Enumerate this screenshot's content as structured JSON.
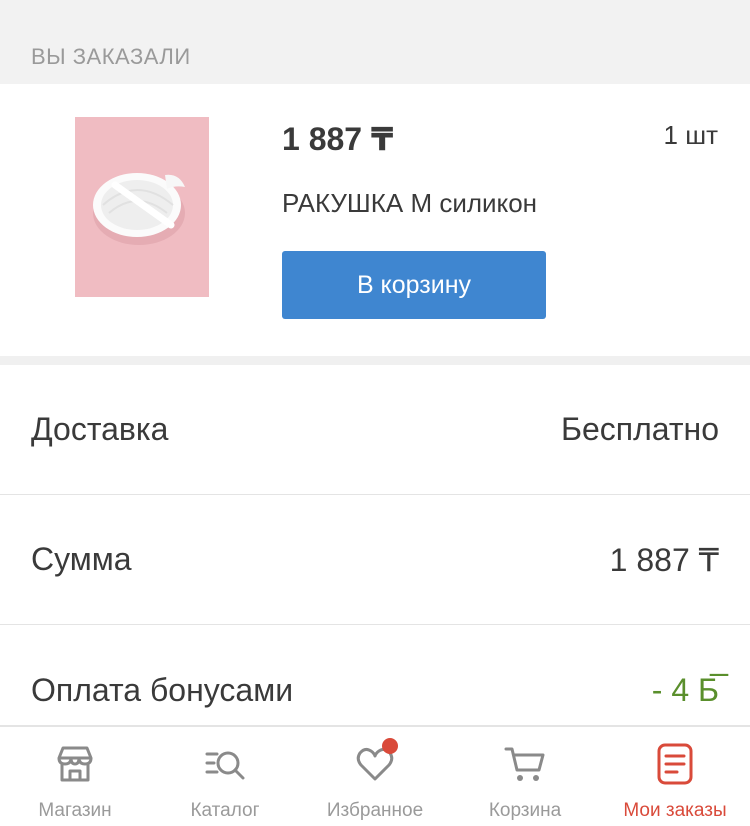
{
  "section": {
    "title": "ВЫ ЗАКАЗАЛИ"
  },
  "order_item": {
    "price": "1 887 ₸",
    "quantity": "1 шт",
    "name": "РАКУШКА М силикон",
    "cart_button_label": "В корзину"
  },
  "summary": {
    "delivery": {
      "label": "Доставка",
      "value": "Бесплатно"
    },
    "total": {
      "label": "Сумма",
      "value": "1 887 ₸"
    },
    "bonus": {
      "label": "Оплата бонусами",
      "value": "- 4 Б̅"
    }
  },
  "bottom_nav": {
    "items": [
      {
        "label": "Магазин",
        "icon": "store-icon"
      },
      {
        "label": "Каталог",
        "icon": "catalog-search-icon"
      },
      {
        "label": "Избранное",
        "icon": "heart-icon"
      },
      {
        "label": "Корзина",
        "icon": "cart-icon"
      },
      {
        "label": "Мои заказы",
        "icon": "orders-icon"
      }
    ],
    "active_index": 4
  },
  "colors": {
    "accent_button": "#3f86d0",
    "active_nav": "#d94a3a",
    "bonus_green": "#5a8f2c",
    "notification_dot": "#d94a3a"
  }
}
